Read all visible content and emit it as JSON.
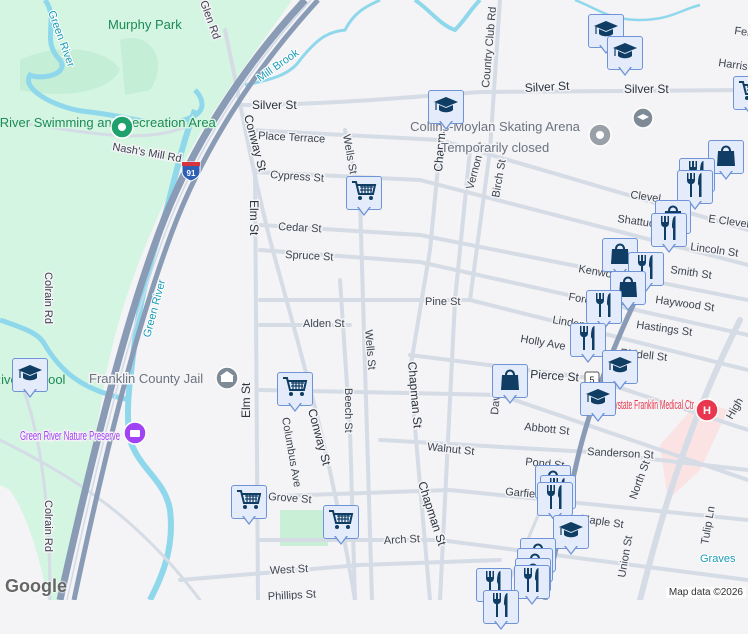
{
  "map": {
    "colors": {
      "park": "#d3f5e1",
      "water": "#8fd8ec",
      "highway": "#8a9bb5",
      "road": "#d5dce5",
      "marker_fill": "#e4ecfb",
      "marker_border": "#6e93d6",
      "marker_icon": "#0f3d63",
      "hospital": "#e8384f",
      "preserve": "#a142f4"
    },
    "streets": [
      "Silver St",
      "Silver St",
      "Silver St",
      "Place Terrace",
      "Cypress St",
      "Cedar St",
      "Spruce St",
      "Pine St",
      "Alden St",
      "Pierce St",
      "Abbott St",
      "Walnut St",
      "Pond St",
      "Garfield",
      "Maple St",
      "Grove St",
      "Arch St",
      "West St",
      "Phillips St",
      "Sanderson St",
      "Hastings St",
      "Holly Ave",
      "Riddell St",
      "Smith St",
      "Haywood St",
      "Lincoln St",
      "E Cleveland",
      "Clevel",
      "Shattuck",
      "Kenwood",
      "Ford",
      "Linden",
      "Harris",
      "Fern",
      "Conway St",
      "Conway St",
      "Elm St",
      "Elm St",
      "Wells St",
      "Wells St",
      "Beech St",
      "Chapman St",
      "Chapman St",
      "Chapman",
      "Vernon St",
      "Birch St",
      "Country Club Rd",
      "North St",
      "Union St",
      "Tulip Ln",
      "Colrain Rd",
      "Colrain Rd",
      "Nash's Mill Rd",
      "Columbus Ave",
      "Davis",
      "Glen Rd",
      "High"
    ],
    "water": [
      "Green River",
      "Green River",
      "Mill Brook"
    ],
    "parks": [
      "Murphy Park",
      "Green River Swimming and Recreation Area",
      "Graves"
    ],
    "pois": {
      "skating": {
        "name": "Collins-Moylan Skating Arena",
        "status": "Temporarily closed"
      },
      "jail": "Franklin County Jail",
      "preserve": "Green River Nature Preserve",
      "hospital": "Baystate Franklin Medical Ctr",
      "school": "Green River School"
    },
    "shields": {
      "interstate": "91",
      "us_route": "5"
    },
    "markers": [
      "school",
      "school",
      "school",
      "grocery",
      "grocery",
      "shopping",
      "restaurant",
      "restaurant",
      "shopping",
      "restaurant",
      "shopping",
      "restaurant",
      "shopping",
      "restaurant",
      "restaurant",
      "school",
      "shopping",
      "school",
      "grocery",
      "school",
      "grocery",
      "grocery",
      "shopping",
      "restaurant",
      "restaurant",
      "school",
      "shopping",
      "shopping",
      "shopping",
      "restaurant",
      "restaurant",
      "restaurant"
    ],
    "attribution": "Map data ©2026",
    "logo": "Google"
  }
}
